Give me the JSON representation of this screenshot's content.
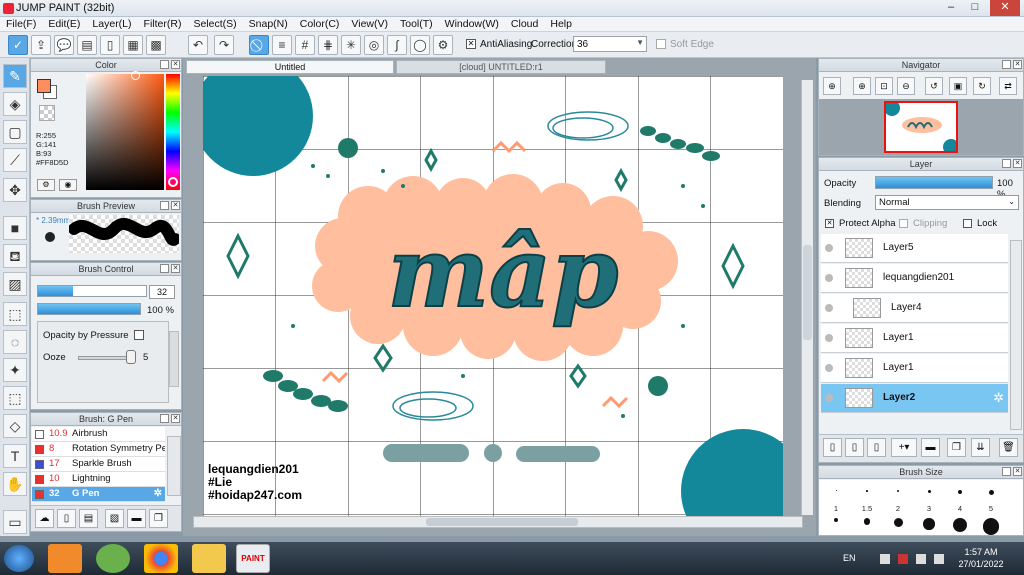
{
  "window": {
    "title": "JUMP PAINT (32bit)",
    "minimize": "–",
    "maximize": "□",
    "close": "✕"
  },
  "menu": [
    "File(F)",
    "Edit(E)",
    "Layer(L)",
    "Filter(R)",
    "Select(S)",
    "Snap(N)",
    "Color(C)",
    "View(V)",
    "Tool(T)",
    "Window(W)",
    "Cloud",
    "Help"
  ],
  "toolbar": {
    "antialiasing_label": "AntiAliasing",
    "antialiasing_checked": "✕",
    "correction_label": "Correction",
    "correction_value": "36",
    "soft_edge_label": "Soft Edge"
  },
  "color_panel": {
    "title": "Color",
    "r": "R:255",
    "g": "G:141",
    "b": "B:93",
    "hex": "#FF8D5D",
    "fg_color": "#ff8d5d"
  },
  "brush_preview": {
    "title": "Brush Preview",
    "size": "* 2.39mm"
  },
  "brush_control": {
    "title": "Brush Control",
    "size_value": "32",
    "size_fraction": 0.32,
    "opacity_value": "100 %",
    "opacity_fraction": 1.0,
    "opacity_by_pressure_label": "Opacity by Pressure",
    "ooze_label": "Ooze",
    "ooze_value": "5"
  },
  "brush_list": {
    "title": "Brush: G Pen",
    "items": [
      {
        "size": "10.9",
        "name": "Airbrush",
        "color": "#ffffff",
        "selected": false
      },
      {
        "size": "8",
        "name": "Rotation Symmetry Pen",
        "color": "#e83030",
        "selected": false
      },
      {
        "size": "17",
        "name": "Sparkle Brush",
        "color": "#3a4fd8",
        "selected": false
      },
      {
        "size": "10",
        "name": "Lightning",
        "color": "#e83030",
        "selected": false
      },
      {
        "size": "32",
        "name": "G Pen",
        "color": "#e83030",
        "selected": true
      }
    ]
  },
  "tabs": [
    {
      "label": "Untitled"
    },
    {
      "label": "[cloud] UNTITLED:r1"
    }
  ],
  "artwork": {
    "main_word": "mâp",
    "credit1": "lequangdien201",
    "credit2": "#Lie",
    "credit3": "#hoidap247.com"
  },
  "navigator": {
    "title": "Navigator"
  },
  "layer_panel": {
    "title": "Layer",
    "opacity_label": "Opacity",
    "opacity_value": "100 %",
    "blending_label": "Blending",
    "blending_value": "Normal",
    "protect_alpha_label": "Protect Alpha",
    "clipping_label": "Clipping",
    "lock_label": "Lock",
    "layers": [
      {
        "name": "Layer5",
        "selected": false,
        "indent": false
      },
      {
        "name": "lequangdien201",
        "selected": false,
        "indent": false
      },
      {
        "name": "Layer4",
        "selected": false,
        "indent": true
      },
      {
        "name": "Layer1",
        "selected": false,
        "indent": false
      },
      {
        "name": "Layer1",
        "selected": false,
        "indent": false
      },
      {
        "name": "Layer2",
        "selected": true,
        "indent": false
      }
    ]
  },
  "brush_size": {
    "title": "Brush Size",
    "sizes": [
      "1",
      "1.5",
      "2",
      "3",
      "4",
      "5"
    ]
  },
  "taskbar": {
    "lang": "EN",
    "time": "1:57 AM",
    "date": "27/01/2022",
    "paint_label": "PAINT"
  },
  "colors": {
    "accent": "#5aa7e6",
    "teal": "#1a7a86",
    "peach": "#ffbf9f"
  }
}
